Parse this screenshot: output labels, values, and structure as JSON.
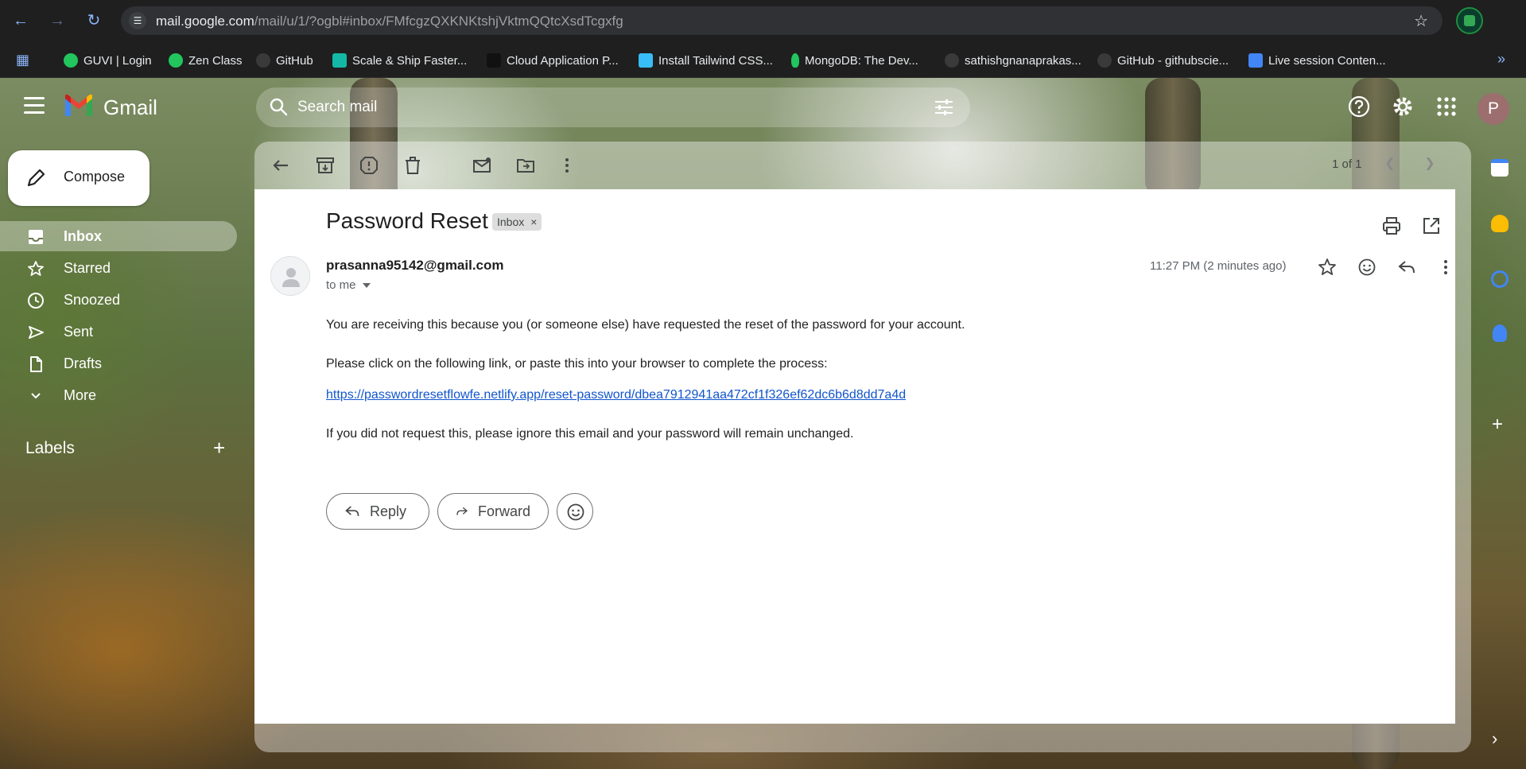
{
  "browser": {
    "url_host": "mail.google.com",
    "url_path": "/mail/u/1/?ogbl#inbox/FMfcgzQXKNKtshjVktmQQtcXsdTcgxfg",
    "bookmarks": [
      {
        "label": "GUVI | Login",
        "color": "#22c55e"
      },
      {
        "label": "Zen Class",
        "color": "#22c55e"
      },
      {
        "label": "GitHub",
        "color": "#3a3a3a"
      },
      {
        "label": "Scale & Ship Faster...",
        "color": "#14b8a6"
      },
      {
        "label": "Cloud Application P...",
        "color": "#111111"
      },
      {
        "label": "Install Tailwind CSS...",
        "color": "#38bdf8"
      },
      {
        "label": "MongoDB: The Dev...",
        "color": "#22c55e"
      },
      {
        "label": "sathishgnanaprakas...",
        "color": "#3a3a3a"
      },
      {
        "label": "GitHub - githubscie...",
        "color": "#3a3a3a"
      },
      {
        "label": "Live session Conten...",
        "color": "#4285f4"
      }
    ]
  },
  "gmail": {
    "logo_text": "Gmail",
    "search_placeholder": "Search mail",
    "avatar_letter": "P",
    "compose_label": "Compose",
    "nav": [
      {
        "label": "Inbox",
        "icon": "inbox-icon",
        "active": true
      },
      {
        "label": "Starred",
        "icon": "star-icon"
      },
      {
        "label": "Snoozed",
        "icon": "clock-icon"
      },
      {
        "label": "Sent",
        "icon": "send-icon"
      },
      {
        "label": "Drafts",
        "icon": "draft-icon"
      },
      {
        "label": "More",
        "icon": "chevron-down-icon"
      }
    ],
    "labels_title": "Labels",
    "pager": "1 of 1"
  },
  "message": {
    "subject": "Password Reset",
    "label_chip": "Inbox",
    "sender": "prasanna95142@gmail.com",
    "to": "to me",
    "timestamp": "11:27 PM (2 minutes ago)",
    "body": [
      "You are receiving this because you (or someone else) have requested the reset of the password for your account.",
      "Please click on the following link, or paste this into your browser to complete the process:",
      "If you did not request this, please ignore this email and your password will remain unchanged."
    ],
    "link": "https://passwordresetflowfe.netlify.app/reset-password/dbea7912941aa472cf1f326ef62dc6b6d8dd7a4d",
    "reply_label": "Reply",
    "forward_label": "Forward"
  }
}
